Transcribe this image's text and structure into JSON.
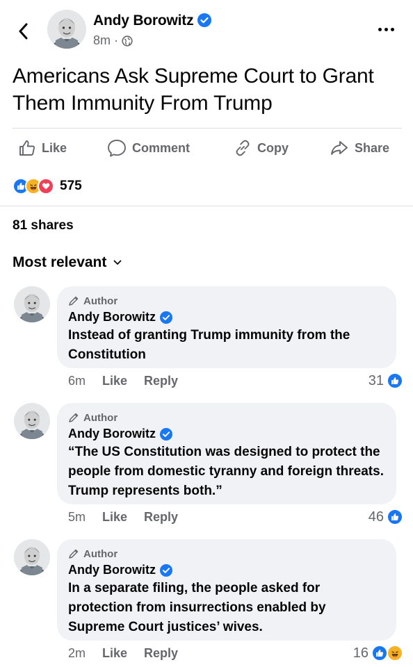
{
  "post": {
    "author": "Andy Borowitz",
    "time": "8m",
    "title": "Americans Ask Supreme Court to Grant Them Immunity From Trump",
    "actions": {
      "like": "Like",
      "comment": "Comment",
      "copy": "Copy",
      "share": "Share"
    },
    "reaction_count": "575",
    "reaction_types": [
      "like-icon",
      "haha-icon",
      "love-icon"
    ],
    "shares": "81 shares"
  },
  "sort_label": "Most relevant",
  "comments": [
    {
      "badge": "Author",
      "author": "Andy Borowitz",
      "text": "Instead of granting Trump immunity from the Constitution",
      "time": "6m",
      "like_label": "Like",
      "reply_label": "Reply",
      "reaction_count": "31",
      "reaction_types": [
        "like-icon"
      ]
    },
    {
      "badge": "Author",
      "author": "Andy Borowitz",
      "text": "“The US Constitution was designed to protect the people from domestic tyranny and foreign threats. Trump represents both.”",
      "time": "5m",
      "like_label": "Like",
      "reply_label": "Reply",
      "reaction_count": "46",
      "reaction_types": [
        "like-icon"
      ]
    },
    {
      "badge": "Author",
      "author": "Andy Borowitz",
      "text": "In a separate filing, the people asked for protection from insurrections enabled by Supreme Court justices’ wives.",
      "time": "2m",
      "like_label": "Like",
      "reply_label": "Reply",
      "reaction_count": "16",
      "reaction_types": [
        "like-icon",
        "haha-icon"
      ]
    }
  ],
  "colors": {
    "accent": "#1877f2",
    "text": "#050505",
    "secondary": "#65676b",
    "bubble": "#f0f2f5",
    "love": "#f33e58",
    "haha": "#f7b125"
  }
}
